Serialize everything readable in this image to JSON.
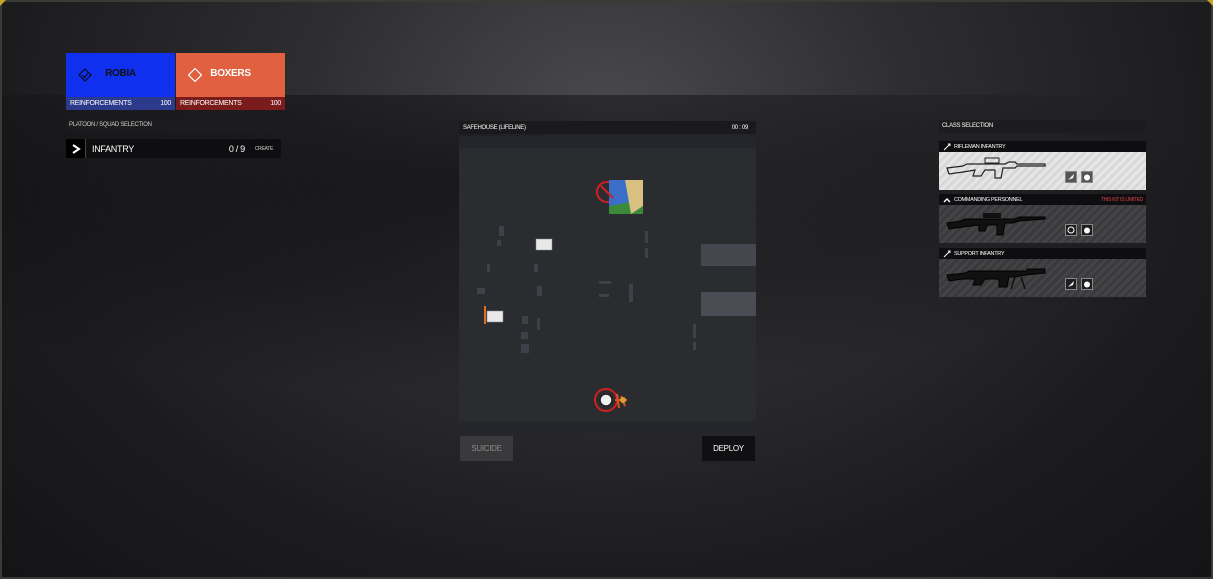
{
  "teams": [
    {
      "name": "ROBIA",
      "reinf_label": "REINFORCEMENTS",
      "reinf_value": "100",
      "color": "#1030f0"
    },
    {
      "name": "BOXERS",
      "reinf_label": "REINFORCEMENTS",
      "reinf_value": "100",
      "color": "#e06040"
    }
  ],
  "squad": {
    "header": "PLATOON / SQUAD SELECTION",
    "name": "INFANTRY",
    "count": "0 / 9",
    "create_label": "CREATE"
  },
  "map": {
    "title": "SAFEHOUSE (LIFELINE)",
    "timer": "00 : 09",
    "suicide_label": "SUICIDE",
    "deploy_label": "DEPLOY"
  },
  "classes": {
    "header": "CLASS SELECTION",
    "kits": [
      {
        "name": "RIFLEMAN INFANTRY",
        "note": "",
        "selected": true,
        "icon": "rifle-icon"
      },
      {
        "name": "COMMANDING PERSONNEL",
        "note": "THIS KIT IS LIMITED",
        "selected": false,
        "icon": "chevron-rank-icon"
      },
      {
        "name": "SUPPORT INFANTRY",
        "note": "",
        "selected": false,
        "icon": "rifle-icon"
      }
    ]
  },
  "colors": {
    "accent_gold": "#c8a42a",
    "limited_red": "#e04848"
  }
}
